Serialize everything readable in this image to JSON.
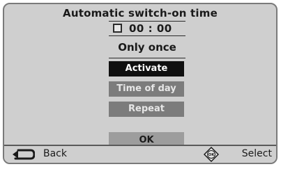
{
  "dialog": {
    "title": "Automatic switch-on time",
    "time": "00 : 00",
    "repeat_mode": "Only once"
  },
  "menu": {
    "items": [
      {
        "label": "Activate",
        "state": "selected"
      },
      {
        "label": "Time of day",
        "state": "normal"
      },
      {
        "label": "Repeat",
        "state": "normal"
      }
    ],
    "ok_label": "OK"
  },
  "footer": {
    "back_label": "Back",
    "back_icon": "back-arrow-icon",
    "ok_icon": "ok-key-icon",
    "ok_icon_text": "OK",
    "select_label": "Select"
  },
  "colors": {
    "background": "#cfcfcf",
    "selected_button": "#101010",
    "normal_button": "#7c7c7c",
    "ok_button": "#9d9d9d"
  }
}
